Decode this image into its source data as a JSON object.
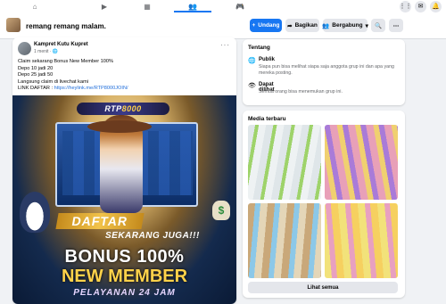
{
  "nav": {
    "tabs": [
      {
        "icon": "home-icon",
        "glyph": "⌂"
      },
      {
        "icon": "video-icon",
        "glyph": "▶"
      },
      {
        "icon": "marketplace-icon",
        "glyph": "▦"
      },
      {
        "icon": "groups-icon",
        "glyph": "👥"
      },
      {
        "icon": "gaming-icon",
        "glyph": "🎮"
      }
    ],
    "right_icons": [
      {
        "icon": "menu-grid-icon",
        "glyph": "⋮⋮"
      },
      {
        "icon": "messenger-icon",
        "glyph": "✉"
      },
      {
        "icon": "notifications-icon",
        "glyph": "🔔"
      }
    ]
  },
  "group": {
    "name": "remang remang malam.",
    "invite_label": "Undang",
    "share_label": "Bagikan",
    "joined_label": "Bergabung",
    "colors": {
      "primary": "#1877f2",
      "secondary_bg": "#e4e6eb"
    }
  },
  "post": {
    "author": "Kampret Kutu Kupret",
    "time": "1 menit",
    "lines": [
      "Claim sekarang Bonus New Member 100%",
      "Depo 10 jadi 20",
      "Depo 25 jadi 50",
      "Langsung claim di livechat kami"
    ],
    "link_label": "LINK DAFTAR :",
    "link_url": "https://heylink.me/RTP8000JOIN/",
    "banner": {
      "logo_prefix": "RTP",
      "logo_number": "8000",
      "daftar": "DAFTAR",
      "sekarang": "SEKARANG JUGA!!!",
      "bonus": "BONUS 100%",
      "member": "NEW MEMBER",
      "pelayanan": "PELAYANAN 24 JAM"
    }
  },
  "about": {
    "title": "Tentang",
    "public_title": "Publik",
    "public_desc": "Siapa pun bisa melihat siapa saja anggota grup ini dan apa yang mereka posting.",
    "visible_title": "Dapat dilihat",
    "visible_desc": "Semua orang bisa menemukan grup ini."
  },
  "media": {
    "title": "Media terbaru",
    "see_all": "Lihat semua"
  }
}
